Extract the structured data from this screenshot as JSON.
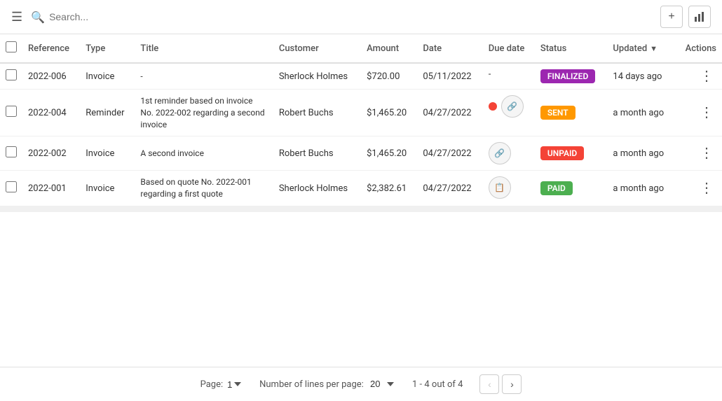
{
  "topbar": {
    "search_placeholder": "Search...",
    "add_btn_icon": "+",
    "chart_btn_icon": "▦"
  },
  "table": {
    "columns": [
      {
        "key": "checkbox",
        "label": ""
      },
      {
        "key": "reference",
        "label": "Reference"
      },
      {
        "key": "type",
        "label": "Type"
      },
      {
        "key": "title",
        "label": "Title"
      },
      {
        "key": "customer",
        "label": "Customer"
      },
      {
        "key": "amount",
        "label": "Amount"
      },
      {
        "key": "date",
        "label": "Date"
      },
      {
        "key": "due_date",
        "label": "Due date"
      },
      {
        "key": "status",
        "label": "Status"
      },
      {
        "key": "updated",
        "label": "Updated"
      },
      {
        "key": "actions",
        "label": "Actions"
      }
    ],
    "rows": [
      {
        "reference": "2022-006",
        "type": "Invoice",
        "title": "-",
        "customer": "Sherlock Holmes",
        "amount": "$720.00",
        "date": "05/11/2022",
        "due_date": "-",
        "status": "FINALIZED",
        "status_key": "finalized",
        "updated": "14 days ago",
        "has_red_dot": false,
        "has_link_icon": false,
        "has_copy_icon": false
      },
      {
        "reference": "2022-004",
        "type": "Reminder",
        "title": "1st reminder based on invoice No. 2022-002 regarding a second invoice",
        "customer": "Robert Buchs",
        "amount": "$1,465.20",
        "date": "04/27/2022",
        "due_date": "",
        "status": "SENT",
        "status_key": "sent",
        "updated": "a month ago",
        "has_red_dot": true,
        "has_link_icon": true,
        "has_copy_icon": false
      },
      {
        "reference": "2022-002",
        "type": "Invoice",
        "title": "A second invoice",
        "customer": "Robert Buchs",
        "amount": "$1,465.20",
        "date": "04/27/2022",
        "due_date": "-",
        "status": "UNPAID",
        "status_key": "unpaid",
        "updated": "a month ago",
        "has_red_dot": false,
        "has_link_icon": true,
        "has_copy_icon": false
      },
      {
        "reference": "2022-001",
        "type": "Invoice",
        "title": "Based on quote No. 2022-001 regarding a first quote",
        "customer": "Sherlock Holmes",
        "amount": "$2,382.61",
        "date": "04/27/2022",
        "due_date": "-",
        "status": "PAID",
        "status_key": "paid",
        "updated": "a month ago",
        "has_red_dot": false,
        "has_link_icon": false,
        "has_copy_icon": true
      }
    ]
  },
  "footer": {
    "page_label": "Page:",
    "page_value": "1",
    "lines_label": "Number of lines per page:",
    "lines_value": "20",
    "count_label": "1 - 4 out of 4"
  }
}
